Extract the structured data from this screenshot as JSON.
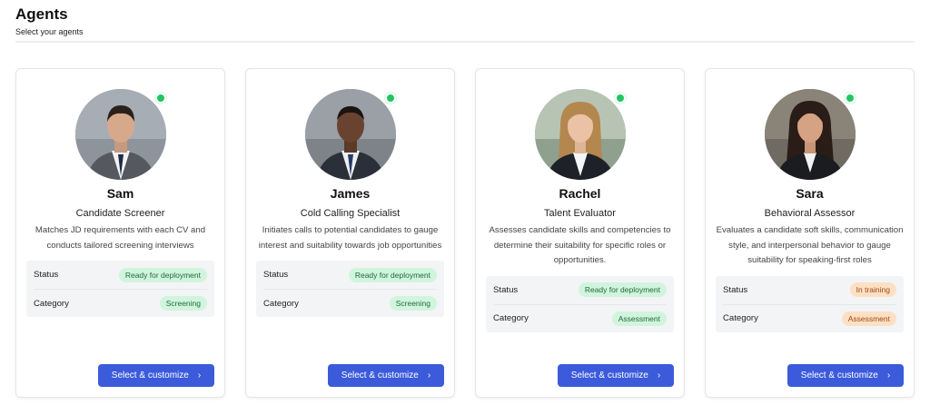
{
  "page": {
    "title": "Agents",
    "subtitle": "Select your agents"
  },
  "labels": {
    "status": "Status",
    "category": "Category",
    "button": "Select & customize"
  },
  "colors": {
    "online": "#22c55e",
    "button": "#3b5bdb",
    "badge_green_bg": "#d1f4dd",
    "badge_orange_bg": "#fde0c4"
  },
  "agents": [
    {
      "name": "Sam",
      "role": "Candidate Screener",
      "description": "Matches JD requirements with each CV and conducts tailored screening interviews",
      "status": "Ready for deployment",
      "category": "Screening",
      "status_color": "green",
      "category_color": "green"
    },
    {
      "name": "James",
      "role": "Cold Calling Specialist",
      "description": "Initiates calls to potential candidates to gauge interest and suitability towards job opportunities",
      "status": "Ready for deployment",
      "category": "Screening",
      "status_color": "green",
      "category_color": "green"
    },
    {
      "name": "Rachel",
      "role": "Talent Evaluator",
      "description": "Assesses candidate skills and competencies to determine their suitability for specific roles or opportunities.",
      "status": "Ready for deployment",
      "category": "Assessment",
      "status_color": "green",
      "category_color": "green"
    },
    {
      "name": "Sara",
      "role": "Behavioral Assessor",
      "description": "Evaluates a candidate soft skills, communication style, and interpersonal behavior to gauge suitability for speaking-first roles",
      "status": "In training",
      "category": "Assessment",
      "status_color": "orange",
      "category_color": "orange"
    }
  ]
}
